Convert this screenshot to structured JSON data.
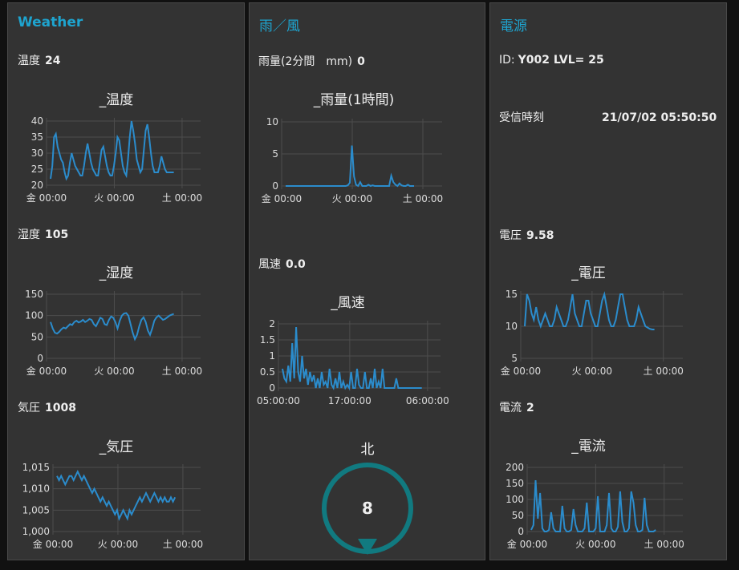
{
  "weather": {
    "title": "Weather",
    "temp": {
      "label": "温度",
      "value": "24"
    },
    "humidity": {
      "label": "湿度",
      "value": "105"
    },
    "pressure": {
      "label": "気圧",
      "value": "1008"
    }
  },
  "rainwind": {
    "title": "雨／風",
    "rain": {
      "label": "雨量(2分間　mm)",
      "value": "0"
    },
    "wind": {
      "label": "風速",
      "value": "0.0"
    },
    "gauge": {
      "label": "北",
      "value": "8",
      "pointer": "down"
    }
  },
  "power": {
    "title": "電源",
    "id_prefix": "ID:",
    "id_value": "Y002 LVL= 25",
    "received_label": "受信時刻",
    "received_value": "21/07/02 05:50:50",
    "voltage": {
      "label": "電圧",
      "value": "9.58"
    },
    "current": {
      "label": "電流",
      "value": "2"
    }
  },
  "colors": {
    "background": "#111111",
    "panel": "#333333",
    "accent": "#1ea4cf",
    "series": "#2b8ccc",
    "gauge": "#117a80"
  },
  "chart_data": [
    {
      "type": "line",
      "title": "_温度",
      "xticks": [
        "金 00:00",
        "火 00:00",
        "土 00:00"
      ],
      "yticks": [
        "40",
        "35",
        "30",
        "25",
        "20"
      ],
      "ylim": [
        20,
        40
      ],
      "grid": true,
      "values": [
        22,
        26,
        35,
        36,
        32,
        30,
        28,
        27,
        24,
        22,
        23,
        27,
        30,
        28,
        26,
        25,
        24,
        23,
        23,
        26,
        30,
        33,
        30,
        27,
        25,
        24,
        23,
        23,
        27,
        31,
        32,
        29,
        26,
        24,
        23,
        23,
        26,
        30,
        35,
        34,
        30,
        26,
        24,
        23,
        28,
        35,
        40,
        37,
        33,
        28,
        26,
        24,
        25,
        31,
        37,
        39,
        35,
        30,
        26,
        24,
        24,
        24,
        26,
        29,
        27,
        25,
        24,
        24,
        24,
        24,
        24
      ]
    },
    {
      "type": "line",
      "title": "_湿度",
      "xticks": [
        "金 00:00",
        "火 00:00",
        "土 00:00"
      ],
      "yticks": [
        "150",
        "100",
        "50",
        "0"
      ],
      "ylim": [
        0,
        150
      ],
      "grid": true,
      "values": [
        85,
        70,
        60,
        58,
        62,
        68,
        72,
        70,
        75,
        80,
        78,
        85,
        88,
        84,
        86,
        90,
        85,
        88,
        92,
        90,
        80,
        75,
        85,
        95,
        92,
        80,
        78,
        90,
        98,
        95,
        85,
        70,
        88,
        100,
        105,
        106,
        100,
        80,
        60,
        45,
        55,
        75,
        90,
        96,
        85,
        65,
        55,
        70,
        88,
        96,
        100,
        95,
        90,
        92,
        96,
        100,
        102,
        104
      ]
    },
    {
      "type": "line",
      "title": "_気圧",
      "xticks": [
        "金 00:00",
        "火 00:00",
        "土 00:00"
      ],
      "yticks": [
        "1,015",
        "1,010",
        "1,005",
        "1,000"
      ],
      "ylim": [
        1000,
        1015
      ],
      "grid": true,
      "values": [
        1013,
        1012,
        1013,
        1012,
        1011,
        1012,
        1013,
        1013,
        1012,
        1013,
        1014,
        1013,
        1012,
        1013,
        1012,
        1011,
        1010,
        1009,
        1010,
        1009,
        1008,
        1007,
        1008,
        1007,
        1006,
        1007,
        1006,
        1005,
        1004,
        1005,
        1003,
        1004,
        1005,
        1004,
        1003,
        1005,
        1004,
        1005,
        1006,
        1007,
        1008,
        1007,
        1008,
        1009,
        1008,
        1007,
        1008,
        1009,
        1008,
        1007,
        1008,
        1007,
        1008,
        1007,
        1007,
        1008,
        1007,
        1008
      ]
    },
    {
      "type": "line",
      "title": "_雨量(1時間)",
      "xticks": [
        "金 00:00",
        "火 00:00",
        "土 00:00"
      ],
      "yticks": [
        "10",
        "5",
        "0"
      ],
      "ylim": [
        0,
        10
      ],
      "grid": true,
      "values": [
        0,
        0,
        0,
        0,
        0,
        0,
        0,
        0,
        0,
        0,
        0,
        0,
        0,
        0,
        0,
        0,
        0,
        0,
        0,
        0,
        0,
        0,
        0,
        0,
        0,
        0,
        0,
        0,
        0,
        0,
        0.1,
        0.5,
        6.3,
        1.5,
        0.2,
        0,
        0.6,
        0,
        0,
        0,
        0.2,
        0,
        0.1,
        0,
        0,
        0,
        0,
        0,
        0,
        0,
        0,
        1.6,
        0.6,
        0.2,
        0,
        0.4,
        0.1,
        0,
        0,
        0.2,
        0,
        0,
        0
      ]
    },
    {
      "type": "line",
      "title": "_風速",
      "xticks": [
        "05:00:00",
        "17:00:00",
        "06:00:00"
      ],
      "yticks": [
        "2",
        "1.5",
        "1",
        "0.5",
        "0"
      ],
      "ylim": [
        0,
        2
      ],
      "grid": true,
      "values": [
        0.6,
        0.3,
        0.2,
        0.7,
        0.2,
        1.4,
        0.3,
        1.9,
        0.5,
        0.2,
        1.0,
        0.3,
        0.6,
        0.1,
        0.5,
        0.2,
        0.4,
        0,
        0.3,
        0,
        0.5,
        0.1,
        0.2,
        0,
        0.6,
        0.1,
        0,
        0.3,
        0,
        0.5,
        0,
        0.2,
        0,
        0.1,
        0,
        0.5,
        0,
        0,
        0.6,
        0.1,
        0,
        0,
        0.5,
        0,
        0,
        0.3,
        0,
        0.6,
        0,
        0.2,
        0,
        0.6,
        0,
        0,
        0,
        0,
        0,
        0,
        0.3,
        0,
        0,
        0,
        0,
        0,
        0,
        0,
        0,
        0,
        0,
        0,
        0,
        0
      ]
    },
    {
      "type": "line",
      "title": "_電圧",
      "xticks": [
        "金 00:00",
        "火 00:00",
        "土 00:00"
      ],
      "yticks": [
        "15",
        "10",
        "5"
      ],
      "ylim": [
        5,
        15
      ],
      "grid": true,
      "values": [
        10,
        15,
        14,
        12,
        11,
        13,
        11,
        10,
        11,
        12,
        11,
        10,
        10,
        11,
        13,
        12,
        11,
        10,
        10,
        11,
        13,
        15,
        12,
        11,
        10,
        10,
        12,
        14,
        14,
        12,
        11,
        10,
        10,
        12,
        14,
        15,
        13,
        11,
        10,
        10,
        11,
        13,
        15,
        15,
        13,
        11,
        10,
        10,
        10,
        11,
        13,
        12,
        11,
        10,
        9.8,
        9.6,
        9.5,
        9.5
      ]
    },
    {
      "type": "line",
      "title": "_電流",
      "xticks": [
        "金 00:00",
        "火 00:00",
        "土 00:00"
      ],
      "yticks": [
        "200",
        "150",
        "100",
        "50",
        "0"
      ],
      "ylim": [
        0,
        200
      ],
      "grid": true,
      "values": [
        5,
        20,
        160,
        40,
        120,
        10,
        0,
        0,
        5,
        60,
        10,
        0,
        0,
        0,
        80,
        10,
        0,
        0,
        5,
        70,
        20,
        0,
        0,
        0,
        10,
        90,
        0,
        0,
        0,
        10,
        110,
        0,
        0,
        0,
        20,
        120,
        10,
        0,
        0,
        15,
        125,
        30,
        0,
        0,
        10,
        125,
        90,
        20,
        0,
        0,
        5,
        105,
        20,
        0,
        0,
        0,
        5
      ]
    }
  ]
}
